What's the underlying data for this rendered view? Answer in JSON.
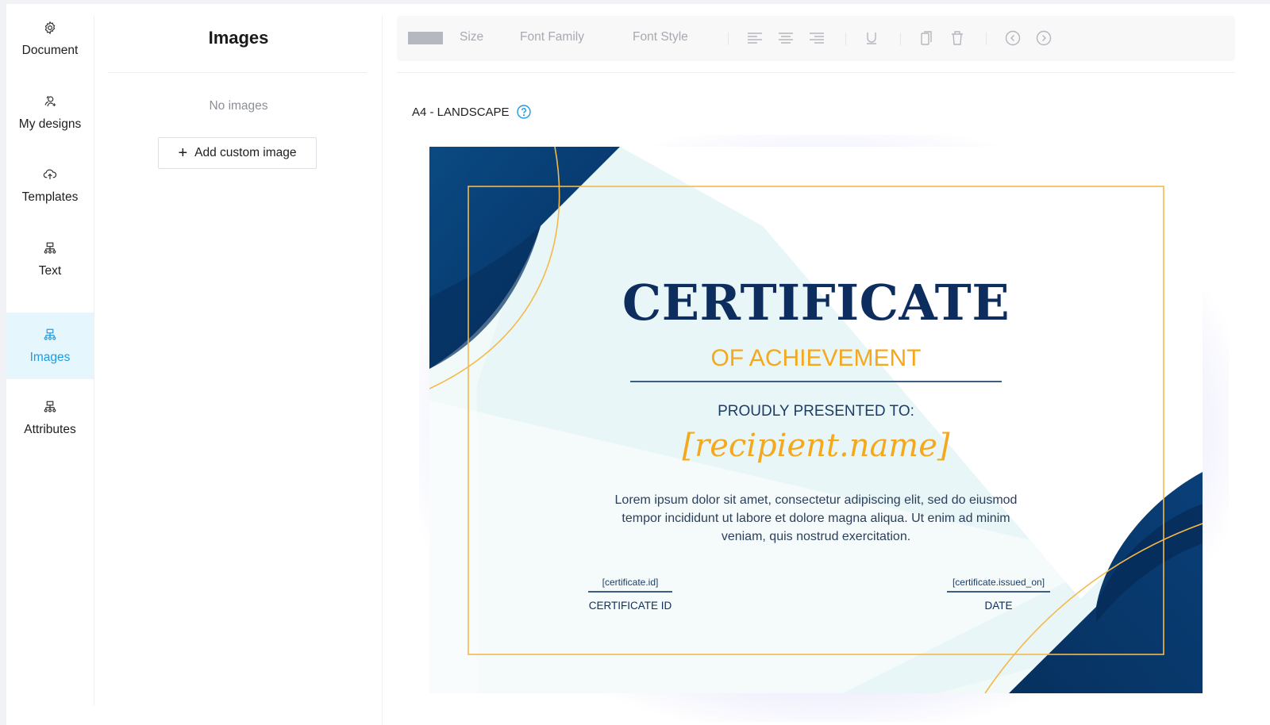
{
  "nav": {
    "items": [
      {
        "label": "Document",
        "icon": "gear-icon",
        "active": false
      },
      {
        "label": "My designs",
        "icon": "user-add-icon",
        "active": false
      },
      {
        "label": "Templates",
        "icon": "cloud-upload-icon",
        "active": false
      },
      {
        "label": "Text",
        "icon": "sitemap-icon",
        "active": false
      },
      {
        "label": "Images",
        "icon": "sitemap-icon",
        "active": true
      },
      {
        "label": "Attributes",
        "icon": "sitemap-icon",
        "active": false
      }
    ]
  },
  "panel": {
    "title": "Images",
    "empty_text": "No images",
    "add_button_label": "Add custom image",
    "add_button_icon": "plus-icon"
  },
  "toolbar": {
    "size_label": "Size",
    "font_family_label": "Font Family",
    "font_style_label": "Font Style",
    "icons": [
      "color-swatch",
      "align-left-icon",
      "align-center-icon",
      "align-right-icon",
      "underline-icon",
      "copy-icon",
      "trash-icon",
      "undo-icon",
      "redo-icon"
    ]
  },
  "page": {
    "format_label": "A4 - LANDSCAPE",
    "help_icon": "question-circle-icon"
  },
  "certificate": {
    "title": "CERTIFICATE",
    "subtitle": "OF ACHIEVEMENT",
    "presented_to": "PROUDLY PRESENTED TO:",
    "recipient": "[recipient.name]",
    "body": "Lorem ipsum dolor sit amet, consectetur adipiscing elit, sed do eiusmod tempor incididunt ut labore et dolore magna aliqua. Ut enim ad minim veniam, quis nostrud exercitation.",
    "left_field": {
      "placeholder": "[certificate.id]",
      "caption": "CERTIFICATE ID"
    },
    "right_field": {
      "placeholder": "[certificate.issued_on]",
      "caption": "DATE"
    },
    "colors": {
      "navy": "#0c2d5e",
      "gold": "#f5a81c",
      "accent_blue": "#1d9be3"
    }
  }
}
